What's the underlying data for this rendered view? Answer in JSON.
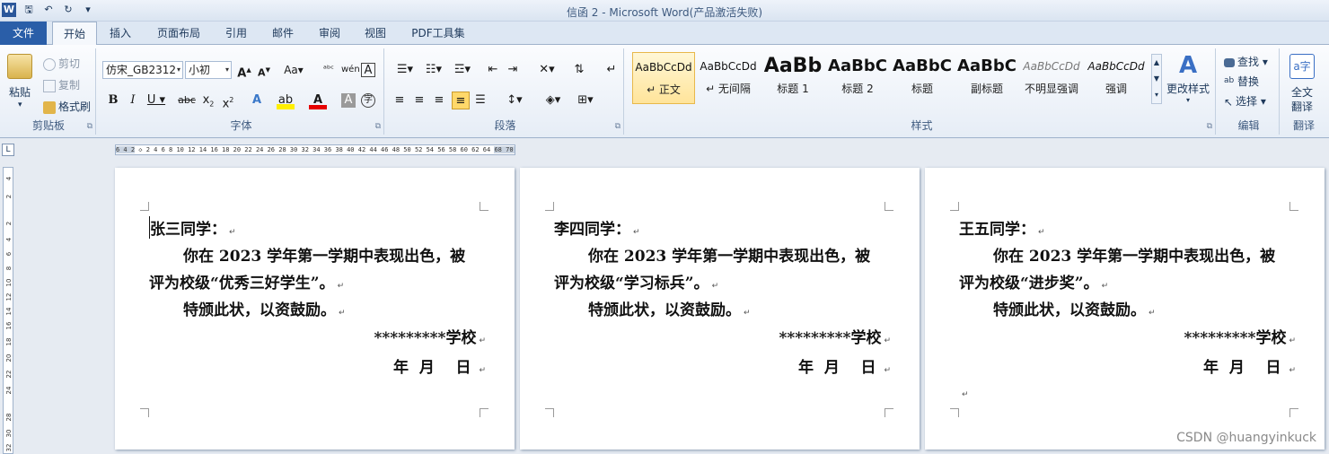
{
  "titlebar": {
    "title": "信函 2  -  Microsoft Word(产品激活失败)"
  },
  "tabs": [
    "文件",
    "开始",
    "插入",
    "页面布局",
    "引用",
    "邮件",
    "审阅",
    "视图",
    "PDF工具集"
  ],
  "clipboard": {
    "paste": "粘贴",
    "cut": "剪切",
    "copy": "复制",
    "format_painter": "格式刷",
    "label": "剪贴板"
  },
  "font": {
    "name": "仿宋_GB2312",
    "size": "小初",
    "label": "字体",
    "change_case": "Aa"
  },
  "paragraph": {
    "label": "段落"
  },
  "styles": {
    "label": "样式",
    "items": [
      {
        "sample": "AaBbCcDd",
        "name": "↵ 正文"
      },
      {
        "sample": "AaBbCcDd",
        "name": "↵ 无间隔"
      },
      {
        "sample": "AaBb",
        "name": "标题 1"
      },
      {
        "sample": "AaBbC",
        "name": "标题 2"
      },
      {
        "sample": "AaBbC",
        "name": "标题"
      },
      {
        "sample": "AaBbC",
        "name": "副标题"
      },
      {
        "sample": "AaBbCcDd",
        "name": "不明显强调"
      },
      {
        "sample": "AaBbCcDd",
        "name": "强调"
      }
    ],
    "change_styles": "更改样式"
  },
  "editing": {
    "find": "查找",
    "replace": "替换",
    "select": "选择",
    "label": "编辑"
  },
  "translate": {
    "full": "全文",
    "translate": "翻译",
    "label": "翻译"
  },
  "ruler": {
    "left": "6 4 2",
    "ticks": "2 4 6 8 10 12 14 16 18 20 22 24 26 28 30 32 34 36 38 40 42 44 46 48 50 52 54 56 58 60 62 64",
    "right": "68 70 72"
  },
  "pages": [
    {
      "salutation": "张三同学：",
      "line1": "你在 2023 学年第一学期中表现出色，被",
      "line2": "评为校级“优秀三好学生”。",
      "line3": "特颁此状，以资鼓励。",
      "school": "*********学校",
      "date": "年  月    日"
    },
    {
      "salutation": "李四同学：",
      "line1": "你在 2023 学年第一学期中表现出色，被",
      "line2": "评为校级“学习标兵”。",
      "line3": "特颁此状，以资鼓励。",
      "school": "*********学校",
      "date": "年  月    日"
    },
    {
      "salutation": "王五同学：",
      "line1": "你在 2023 学年第一学期中表现出色，被",
      "line2": "评为校级“进步奖”。",
      "line3": "特颁此状，以资鼓励。",
      "school": "*********学校",
      "date": "年  月    日"
    }
  ],
  "vruler_ticks": [
    "4",
    "2",
    "2",
    "4",
    "6",
    "8",
    "10",
    "12",
    "14",
    "16",
    "18",
    "20",
    "22",
    "24",
    "28",
    "30",
    "32"
  ],
  "watermark": "CSDN @huangyinkuck"
}
